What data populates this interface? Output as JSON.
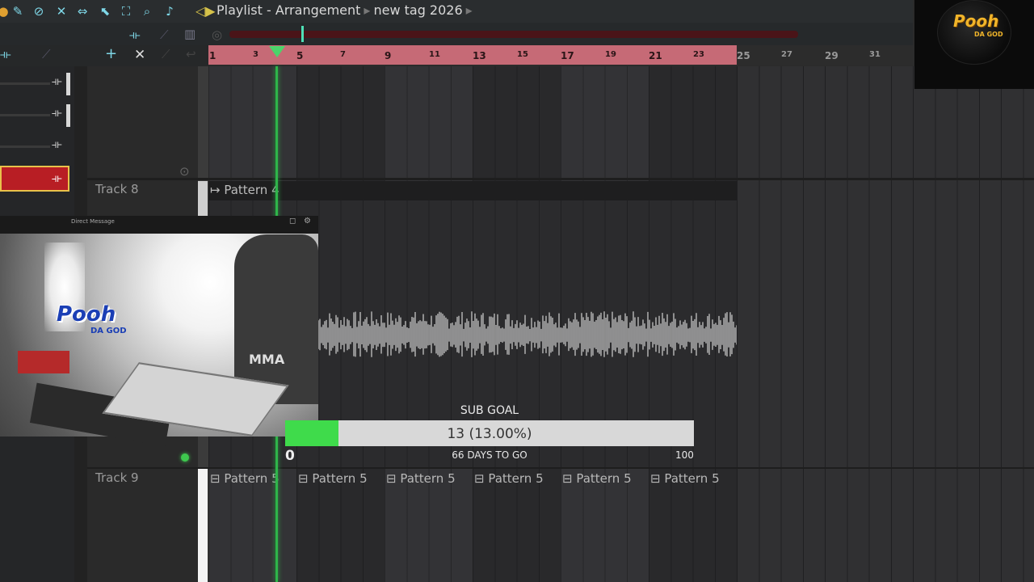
{
  "toolbar": {
    "title": "Playlist - Arrangement",
    "separator": "▸",
    "breadcrumb": "new tag 2026",
    "icons": [
      "record-icon",
      "paint-icon",
      "mute-icon",
      "speaker-mute-icon",
      "stretch-icon",
      "select-icon",
      "zoom-box-icon",
      "zoom-icon",
      "speaker-icon"
    ]
  },
  "ruler": {
    "ticks": [
      "1",
      "3",
      "5",
      "7",
      "9",
      "11",
      "13",
      "15",
      "17",
      "19",
      "21",
      "23",
      "25",
      "27",
      "29",
      "31"
    ]
  },
  "tracks": {
    "track8": {
      "label": "Track 8",
      "pattern": "Pattern 4"
    },
    "track9": {
      "label": "Track 9",
      "patterns": [
        "Pattern 5",
        "Pattern 5",
        "Pattern 5",
        "Pattern 5",
        "Pattern 5",
        "Pattern 5"
      ]
    }
  },
  "webcam": {
    "title": "Direct Message",
    "logo_text": "Pooh",
    "logo_sub": "DA GOD",
    "shirt_text": "MMA"
  },
  "sub_goal": {
    "title": "SUB GOAL",
    "value_text": "13 (13.00%)",
    "progress": 0.13,
    "min": "0",
    "max": "100",
    "days_text": "66 DAYS TO GO"
  },
  "brand": {
    "logo": "Pooh",
    "logo_sub": "DA GOD"
  },
  "colors": {
    "ruler": "#c66a76",
    "playhead": "#2fb54a",
    "progress_fill": "#3fdb4b",
    "mixer_selected": "#b81e24"
  }
}
